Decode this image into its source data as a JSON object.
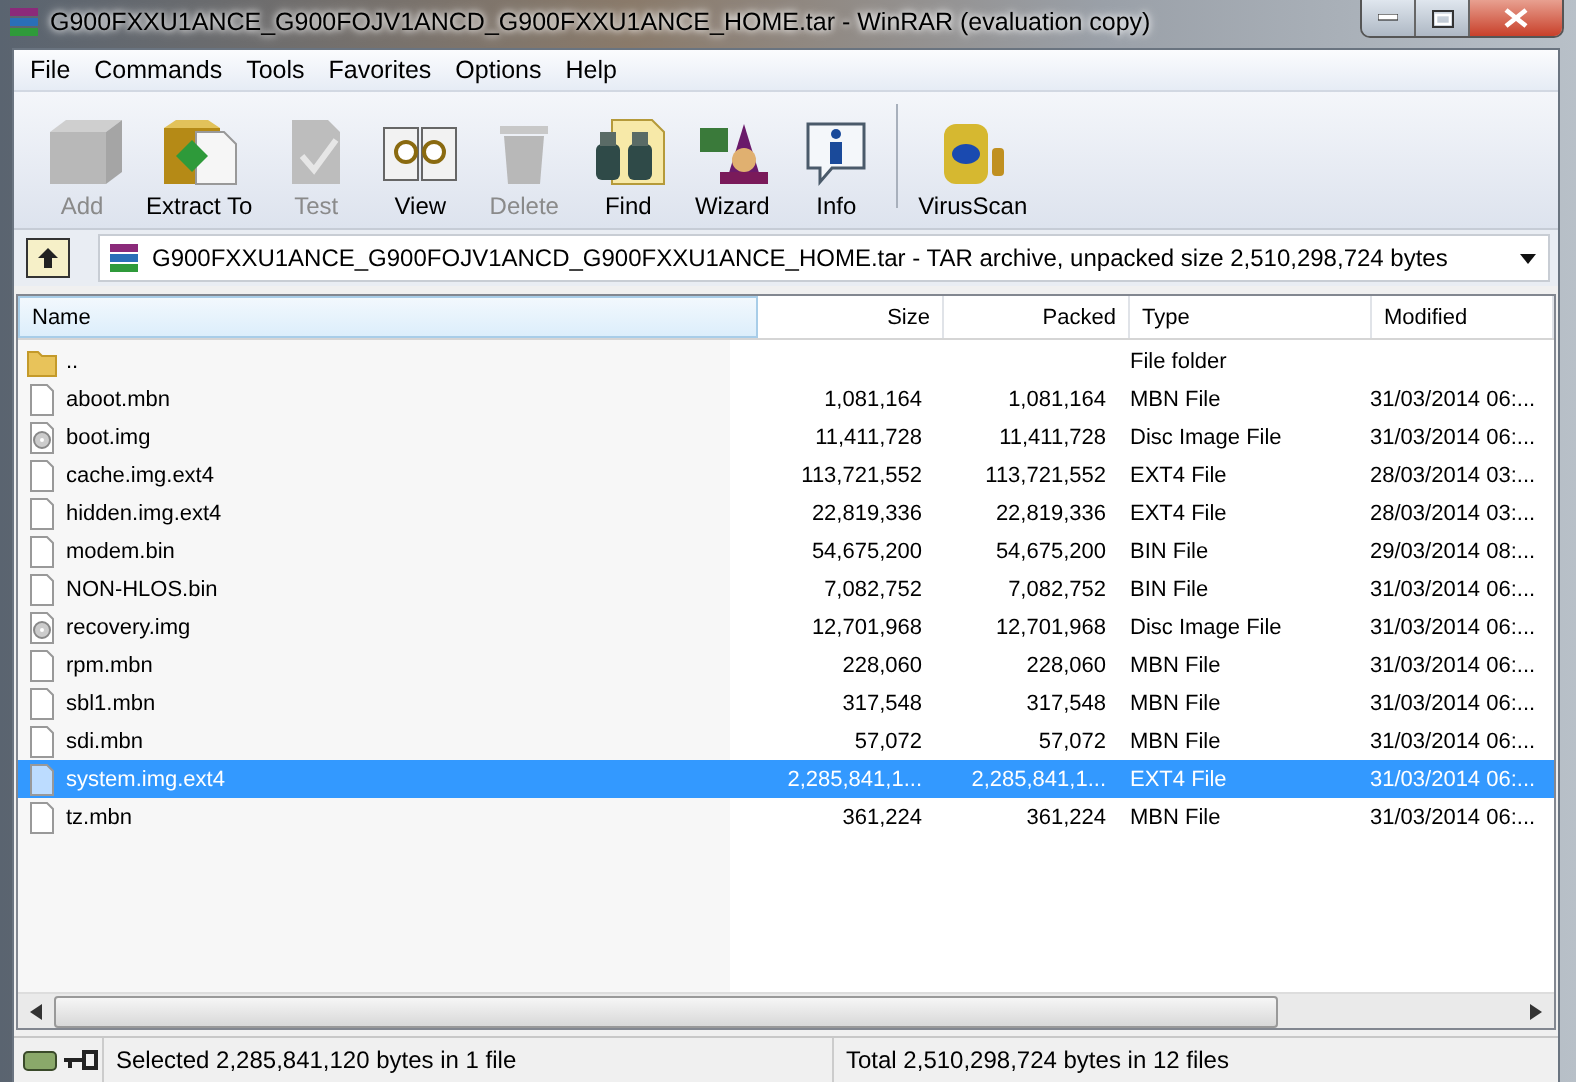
{
  "window": {
    "title": "G900FXXU1ANCE_G900FOJV1ANCD_G900FXXU1ANCE_HOME.tar - WinRAR (evaluation copy)"
  },
  "menu": [
    "File",
    "Commands",
    "Tools",
    "Favorites",
    "Options",
    "Help"
  ],
  "toolbar": [
    {
      "label": "Add",
      "kind": "add",
      "disabled": true
    },
    {
      "label": "Extract To",
      "kind": "extract",
      "disabled": false
    },
    {
      "label": "Test",
      "kind": "test",
      "disabled": true
    },
    {
      "label": "View",
      "kind": "view",
      "disabled": false
    },
    {
      "label": "Delete",
      "kind": "delete",
      "disabled": true
    },
    {
      "label": "Find",
      "kind": "find",
      "disabled": false
    },
    {
      "label": "Wizard",
      "kind": "wizard",
      "disabled": false
    },
    {
      "label": "Info",
      "kind": "info",
      "disabled": false
    },
    {
      "label": "VirusScan",
      "kind": "scan",
      "disabled": false
    }
  ],
  "address": {
    "value": "G900FXXU1ANCE_G900FOJV1ANCD_G900FXXU1ANCE_HOME.tar - TAR archive, unpacked size 2,510,298,724 bytes"
  },
  "table": {
    "columns": [
      "Name",
      "Size",
      "Packed",
      "Type",
      "Modified"
    ],
    "rows": [
      {
        "kind": "folder",
        "name": "..",
        "size": "",
        "packed": "",
        "type": "File folder",
        "modified": "",
        "selected": false
      },
      {
        "kind": "file",
        "name": "aboot.mbn",
        "size": "1,081,164",
        "packed": "1,081,164",
        "type": "MBN File",
        "modified": "31/03/2014 06:...",
        "selected": false
      },
      {
        "kind": "disc",
        "name": "boot.img",
        "size": "11,411,728",
        "packed": "11,411,728",
        "type": "Disc Image File",
        "modified": "31/03/2014 06:...",
        "selected": false
      },
      {
        "kind": "file",
        "name": "cache.img.ext4",
        "size": "113,721,552",
        "packed": "113,721,552",
        "type": "EXT4 File",
        "modified": "28/03/2014 03:...",
        "selected": false
      },
      {
        "kind": "file",
        "name": "hidden.img.ext4",
        "size": "22,819,336",
        "packed": "22,819,336",
        "type": "EXT4 File",
        "modified": "28/03/2014 03:...",
        "selected": false
      },
      {
        "kind": "file",
        "name": "modem.bin",
        "size": "54,675,200",
        "packed": "54,675,200",
        "type": "BIN File",
        "modified": "29/03/2014 08:...",
        "selected": false
      },
      {
        "kind": "file",
        "name": "NON-HLOS.bin",
        "size": "7,082,752",
        "packed": "7,082,752",
        "type": "BIN File",
        "modified": "31/03/2014 06:...",
        "selected": false
      },
      {
        "kind": "disc",
        "name": "recovery.img",
        "size": "12,701,968",
        "packed": "12,701,968",
        "type": "Disc Image File",
        "modified": "31/03/2014 06:...",
        "selected": false
      },
      {
        "kind": "file",
        "name": "rpm.mbn",
        "size": "228,060",
        "packed": "228,060",
        "type": "MBN File",
        "modified": "31/03/2014 06:...",
        "selected": false
      },
      {
        "kind": "file",
        "name": "sbl1.mbn",
        "size": "317,548",
        "packed": "317,548",
        "type": "MBN File",
        "modified": "31/03/2014 06:...",
        "selected": false
      },
      {
        "kind": "file",
        "name": "sdi.mbn",
        "size": "57,072",
        "packed": "57,072",
        "type": "MBN File",
        "modified": "31/03/2014 06:...",
        "selected": false
      },
      {
        "kind": "file",
        "name": "system.img.ext4",
        "size": "2,285,841,1...",
        "packed": "2,285,841,1...",
        "type": "EXT4 File",
        "modified": "31/03/2014 06:...",
        "selected": true
      },
      {
        "kind": "file",
        "name": "tz.mbn",
        "size": "361,224",
        "packed": "361,224",
        "type": "MBN File",
        "modified": "31/03/2014 06:...",
        "selected": false
      }
    ]
  },
  "status_bar": {
    "selection": "Selected 2,285,841,120 bytes in 1 file",
    "total": "Total 2,510,298,724 bytes in 12 files"
  }
}
